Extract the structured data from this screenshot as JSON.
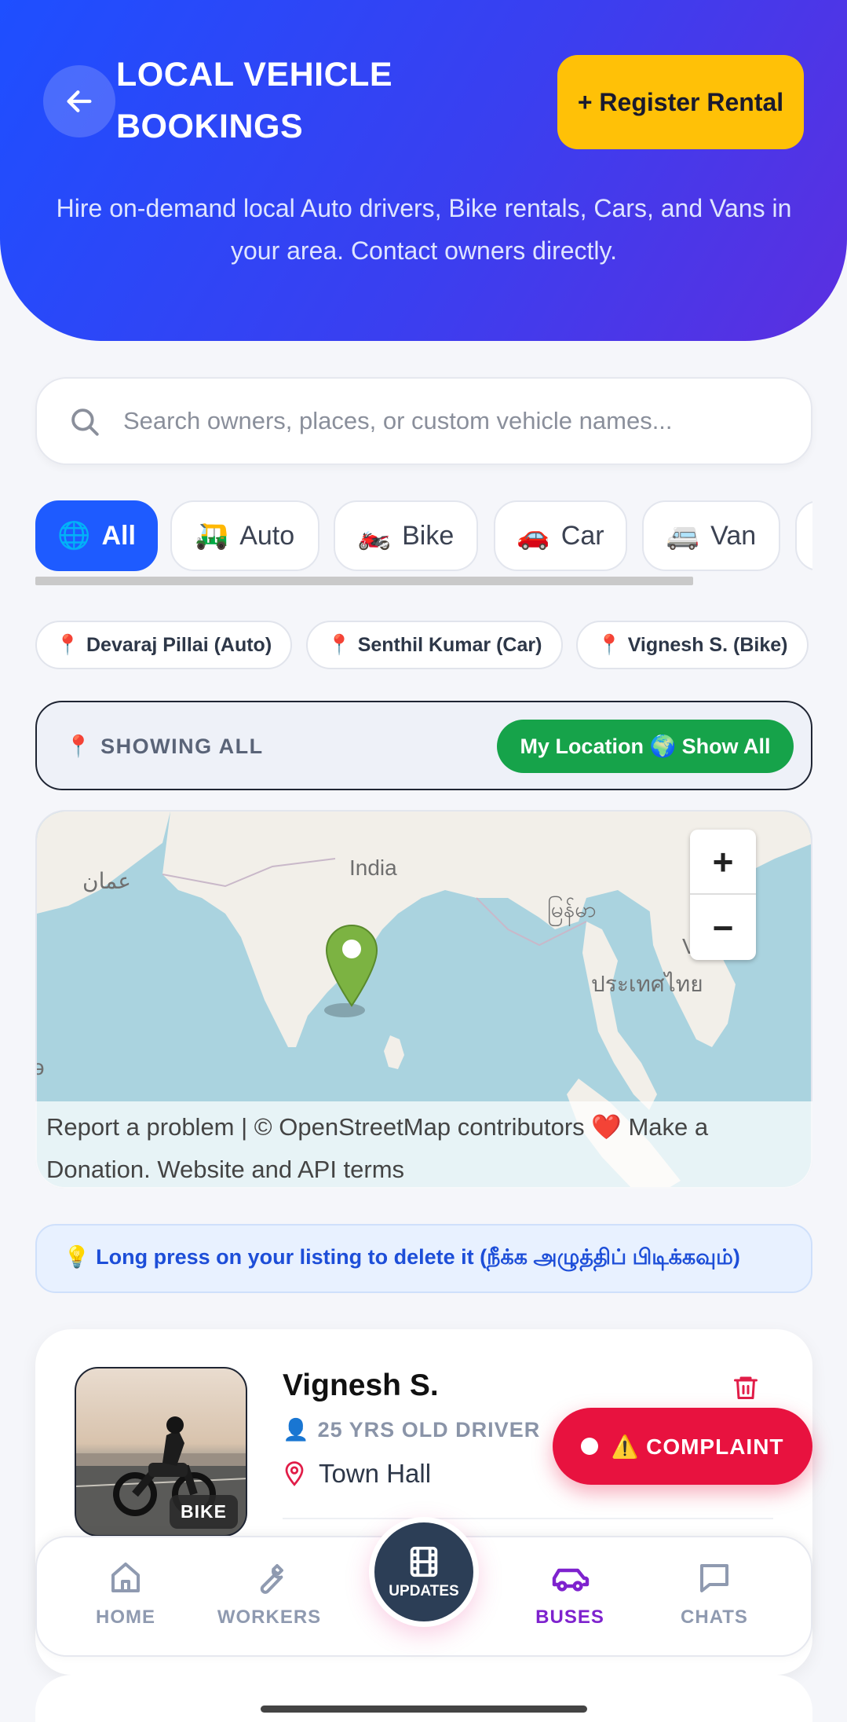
{
  "header": {
    "title": "LOCAL VEHICLE BOOKINGS",
    "register_label": "+ Register Rental",
    "subtitle": "Hire on-demand local Auto drivers, Bike rentals, Cars, and Vans in your area. Contact owners directly."
  },
  "search": {
    "placeholder": "Search owners, places, or custom vehicle names..."
  },
  "categories": [
    {
      "icon": "🌐",
      "label": "All",
      "active": true
    },
    {
      "icon": "🛺",
      "label": "Auto",
      "active": false
    },
    {
      "icon": "🏍️",
      "label": "Bike",
      "active": false
    },
    {
      "icon": "🚗",
      "label": "Car",
      "active": false
    },
    {
      "icon": "🚐",
      "label": "Van",
      "active": false
    }
  ],
  "quick_places": [
    {
      "icon": "📍",
      "label": "Devaraj Pillai (Auto)"
    },
    {
      "icon": "📍",
      "label": "Senthil Kumar (Car)"
    },
    {
      "icon": "📍",
      "label": "Vignesh S. (Bike)"
    }
  ],
  "filter": {
    "icon": "📍",
    "showing_label": "SHOWING ALL",
    "location_button": "My Location 🌍 Show All"
  },
  "map": {
    "labels": {
      "oman": "عمان",
      "india": "India",
      "myanmar": "မြန်မာ",
      "vietnam": "Việt",
      "thailand": "ประเทศไทย",
      "edge": "ə"
    },
    "zoom_in": "+",
    "zoom_out": "−",
    "attribution": "Report a problem | © OpenStreetMap contributors ❤️ Make a Donation. Website and API terms"
  },
  "tip": "💡 Long press on your listing to delete it (நீக்க அழுத்திப் பிடிக்கவும்)",
  "listing": {
    "name": "Vignesh S.",
    "badge": "BIKE",
    "age_icon": "👤",
    "age_text": "25 YRS OLD DRIVER",
    "place": "Town Hall"
  },
  "complaint": {
    "label": "⚠️ COMPLAINT"
  },
  "nav": {
    "home": "HOME",
    "workers": "WORKERS",
    "updates": "UPDATES",
    "buses": "BUSES",
    "chats": "CHATS",
    "active": "buses"
  },
  "colors": {
    "header_start": "#1e4fff",
    "header_end": "#5b2fe0",
    "register": "#ffc107",
    "active_chip": "#1e5bff",
    "location_button": "#16a34a",
    "complaint": "#e8123f",
    "nav_active": "#7e22ce"
  }
}
